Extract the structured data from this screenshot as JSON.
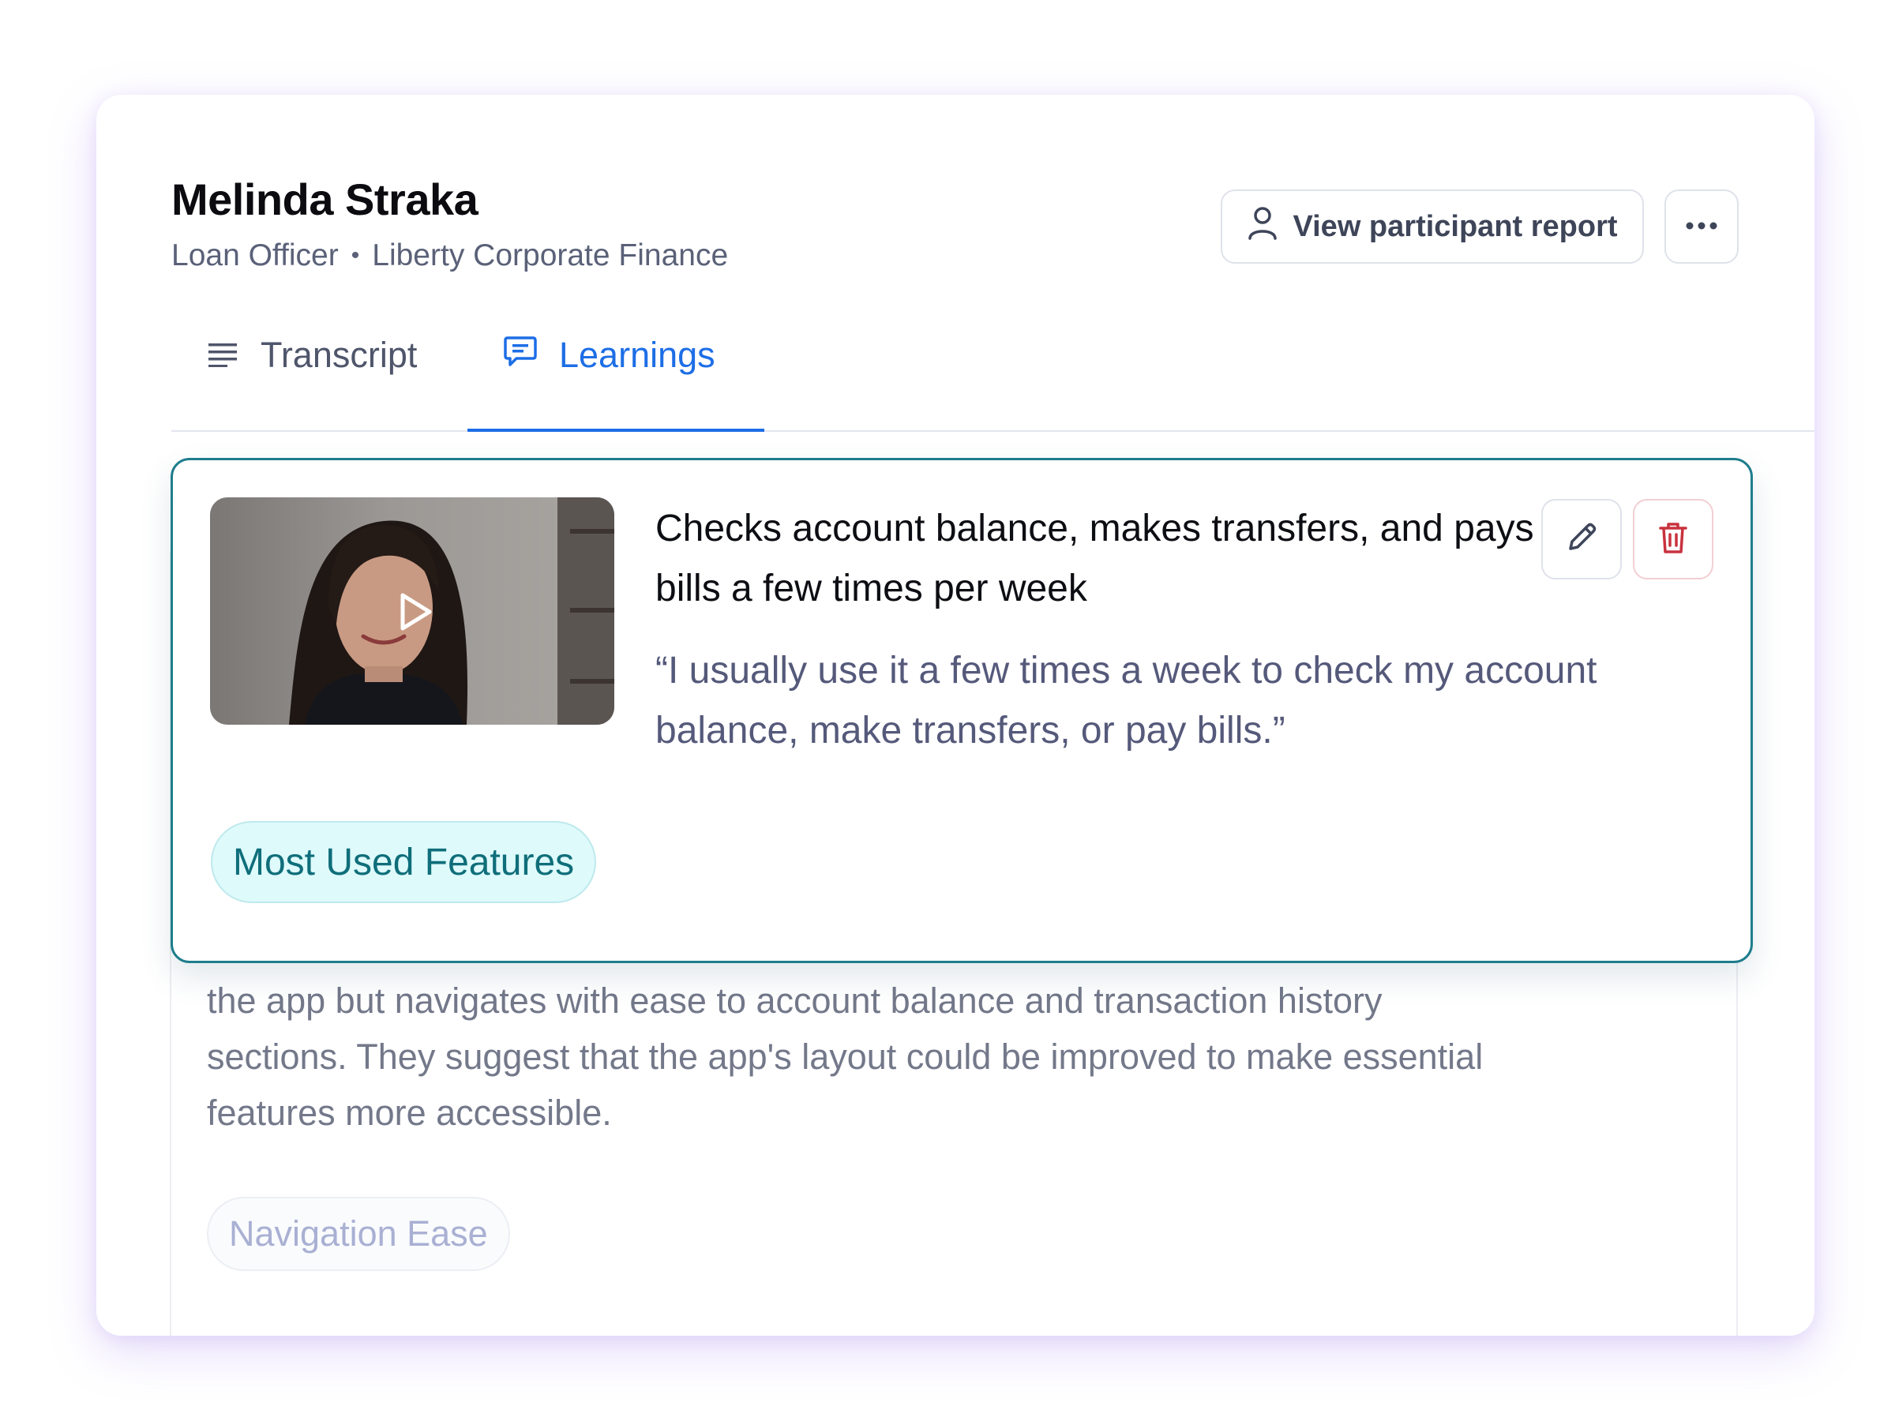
{
  "participant": {
    "name": "Melinda Straka",
    "role": "Loan Officer",
    "separator": "•",
    "company": "Liberty Corporate Finance"
  },
  "header": {
    "report_button_label": "View participant report",
    "report_icon": "user-icon",
    "more_icon": "more-horizontal-icon"
  },
  "tabs": [
    {
      "label": "Transcript",
      "icon": "lines-icon",
      "active": false
    },
    {
      "label": "Learnings",
      "icon": "chat-bubble-icon",
      "active": true
    }
  ],
  "learning": {
    "title": "Checks account balance, makes transfers, and pays bills a few times per week",
    "quote": "“I usually use it a few times a week to check my account balance, make transfers, or pay bills.”",
    "tag": "Most Used Features",
    "video_icon": "play-icon",
    "edit_icon": "pencil-icon",
    "delete_icon": "trash-icon"
  },
  "next_learning": {
    "text": "the app but navigates with ease to account balance and transaction history sections. They suggest that the app's layout could be improved to make essential features more accessible.",
    "tag": "Navigation Ease"
  },
  "colors": {
    "accent": "#1d6ee6",
    "card_border": "#1e7d8c",
    "tag_background": "#defafb",
    "tag_text": "#0f6e7a",
    "delete": "#c8323e",
    "glow": "#c9b8f7"
  }
}
